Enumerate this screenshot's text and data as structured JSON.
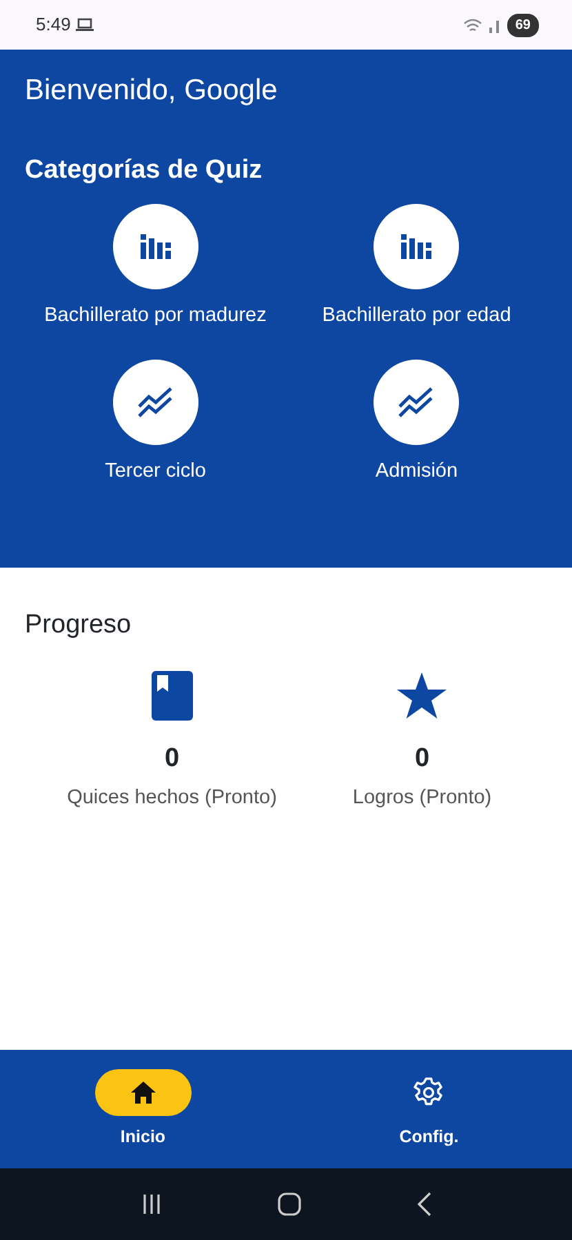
{
  "status_bar": {
    "time": "5:49",
    "battery": "69"
  },
  "header": {
    "greeting": "Bienvenido, Google"
  },
  "categories": {
    "title": "Categorías de Quiz",
    "items": [
      {
        "label": "Bachillerato por madurez",
        "kind": "bars"
      },
      {
        "label": "Bachillerato por edad",
        "kind": "bars"
      },
      {
        "label": "Tercer ciclo",
        "kind": "trend"
      },
      {
        "label": "Admisión",
        "kind": "trend"
      }
    ]
  },
  "progress": {
    "title": "Progreso",
    "items": [
      {
        "kind": "book",
        "value": "0",
        "label": "Quices hechos (Pronto)"
      },
      {
        "kind": "star",
        "value": "0",
        "label": "Logros (Pronto)"
      }
    ]
  },
  "bottom_nav": [
    {
      "label": "Inicio",
      "kind": "home",
      "selected": true
    },
    {
      "label": "Config.",
      "kind": "settings",
      "selected": false
    }
  ]
}
